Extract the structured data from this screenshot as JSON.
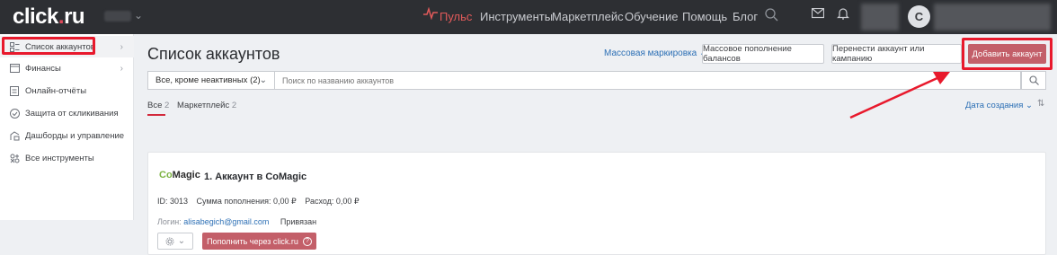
{
  "header": {
    "logo_text": "click",
    "logo_dot": ".",
    "logo_tld": "ru",
    "nav": [
      {
        "label": "Пульс"
      },
      {
        "label": "Инструменты"
      },
      {
        "label": "Маркетплейс"
      },
      {
        "label": "Обучение"
      },
      {
        "label": "Помощь"
      },
      {
        "label": "Блог"
      }
    ],
    "avatar_initial": "C",
    "pulse_color": "#e15a5a",
    "icons": [
      "pulse-icon",
      "search-icon",
      "mail-icon",
      "bell-icon"
    ]
  },
  "sidebar": {
    "items": [
      {
        "label": "Список аккаунтов",
        "icon": "accounts-icon",
        "has_chevron": true,
        "active": true
      },
      {
        "label": "Финансы",
        "icon": "wallet-icon",
        "has_chevron": true
      },
      {
        "label": "Онлайн-отчёты",
        "icon": "report-icon"
      },
      {
        "label": "Защита от скликивания",
        "icon": "shield-icon"
      },
      {
        "label": "Дашборды и управление",
        "icon": "dashboard-icon"
      },
      {
        "label": "Все инструменты",
        "icon": "tools-icon"
      }
    ]
  },
  "main": {
    "title": "Список аккаунтов",
    "mass_marking": "Массовая маркировка",
    "buttons": {
      "mass_topup": "Массовое пополнение балансов",
      "transfer": "Перенести аккаунт или кампанию",
      "add_account": "Добавить аккаунт"
    },
    "filter": {
      "selected": "Все, кроме неактивных (2)",
      "search_placeholder": "Поиск по названию аккаунтов"
    },
    "tabs": [
      {
        "label": "Все",
        "count": "2"
      },
      {
        "label": "Маркетплейс",
        "count": "2"
      }
    ],
    "sort_label": "Дата создания"
  },
  "account_card": {
    "logo_co": "Co",
    "logo_magic": "Magic",
    "name": "1. Аккаунт в CoMagic",
    "id": "ID: 3013",
    "topup_amount": "Сумма пополнения: 0,00 ₽",
    "expense": "Расход: 0,00 ₽",
    "login_label": "Логин:",
    "login_email": "alisabegich@gmail.com",
    "status": "Привязан",
    "topup_button": "Пополнить через click.ru",
    "help_glyph": "?"
  },
  "colors": {
    "header_bg": "#2d2f33",
    "primary_button": "#c35f69",
    "link": "#2c6fb5",
    "highlight": "#e8192c",
    "comagic_green": "#7cb342"
  }
}
